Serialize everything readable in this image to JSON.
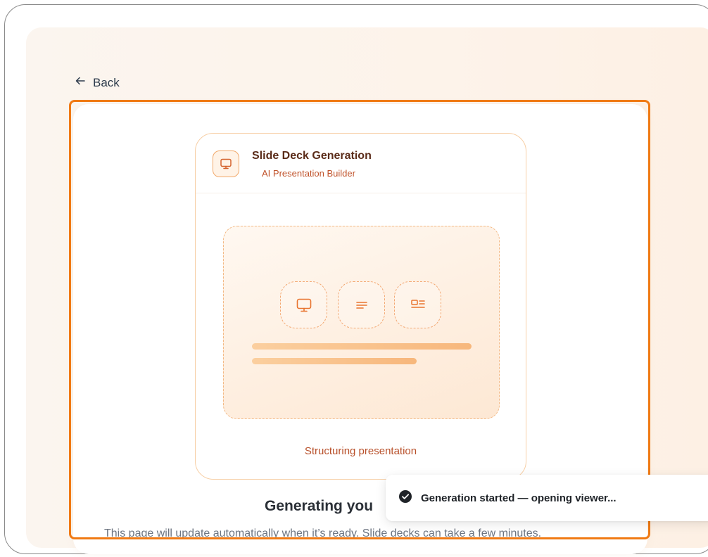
{
  "nav": {
    "back_label": "Back"
  },
  "card": {
    "title": "Slide Deck Generation",
    "subtitle": "AI Presentation Builder",
    "status": "Structuring presentation"
  },
  "page": {
    "heading": "Generating you",
    "description": "This page will update automatically when it’s ready. Slide decks can take a few minutes."
  },
  "toast": {
    "message": "Generation started — opening viewer..."
  },
  "icons": {
    "back": "arrow-left-icon",
    "card": "monitor-icon",
    "tiles": [
      "monitor-icon",
      "text-lines-icon",
      "layout-icon"
    ],
    "toast": "check-circle-icon"
  },
  "colors": {
    "accent": "#f07a14",
    "title": "#5a2b18",
    "subtitle": "#c0522a"
  }
}
